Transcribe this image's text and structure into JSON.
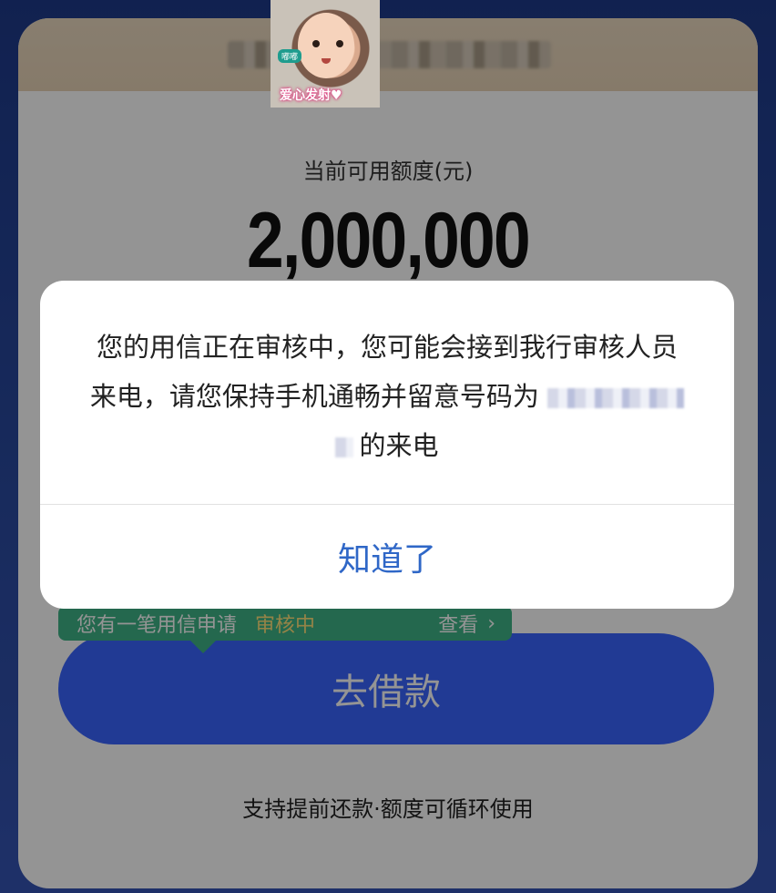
{
  "card": {
    "credit_label": "当前可用额度(元)",
    "credit_amount": "2,000,000"
  },
  "notice": {
    "text": "您有一笔用信申请",
    "status": "审核中",
    "view_label": "查看",
    "chevron": "›"
  },
  "borrow_button": {
    "label": "去借款"
  },
  "footer": {
    "text": "支持提前还款·额度可循环使用"
  },
  "sticker": {
    "small_text": "嘟嘟",
    "caption": "爱心发射♥"
  },
  "dialog": {
    "line1": "您的用信正在审核中，您可能会接到我行审核人员",
    "line2_prefix": "来电，请您保持手机通畅并留意号码为",
    "line3_suffix": "的来电",
    "confirm_label": "知道了"
  },
  "colors": {
    "background": "#1e3a8a",
    "header": "#e7d3b6",
    "primary_button": "#3a64ff",
    "notice_bg": "#3fb487",
    "notice_status": "#ffe27a",
    "dialog_button_text": "#2f67c7"
  }
}
